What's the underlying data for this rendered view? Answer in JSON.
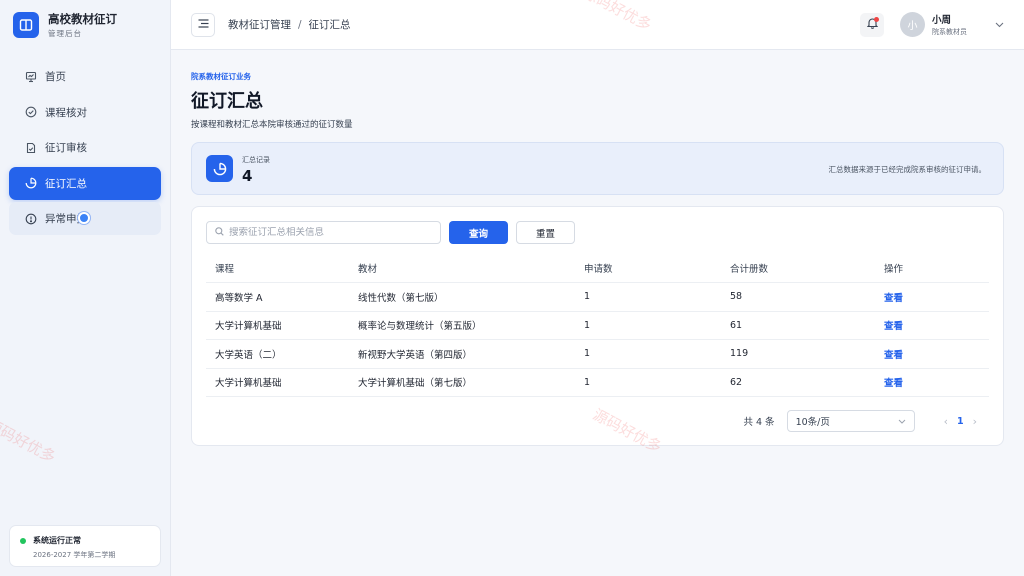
{
  "brand": {
    "title": "高校教材征订",
    "subtitle": "管理后台"
  },
  "sidebar": {
    "items": [
      {
        "label": "首页",
        "icon": "presentation-icon"
      },
      {
        "label": "课程核对",
        "icon": "check-circle-icon"
      },
      {
        "label": "征订审核",
        "icon": "document-check-icon"
      },
      {
        "label": "征订汇总",
        "icon": "pie-chart-icon"
      },
      {
        "label": "异常申报",
        "icon": "alert-circle-icon"
      }
    ],
    "status": {
      "title": "系统运行正常",
      "subtitle": "2026-2027 学年第二学期"
    }
  },
  "header": {
    "breadcrumb": [
      "教材征订管理",
      "征订汇总"
    ],
    "separator": "/",
    "user": {
      "avatar": "小",
      "name": "小周",
      "role": "院系教材员"
    }
  },
  "main": {
    "eyebrow": "院系教材征订业务",
    "title": "征订汇总",
    "description": "按课程和教材汇总本院审核通过的征订数量",
    "summary": {
      "label": "汇总记录",
      "count": "4",
      "note": "汇总数据来源于已经完成院系审核的征订申请。"
    },
    "search": {
      "placeholder": "搜索征订汇总相关信息",
      "value": ""
    },
    "buttons": {
      "query": "查询",
      "reset": "重置"
    },
    "table": {
      "headers": [
        "课程",
        "教材",
        "申请数",
        "合计册数",
        "操作"
      ],
      "rows": [
        [
          "高等数学 A",
          "线性代数（第七版）",
          "1",
          "58",
          "查看"
        ],
        [
          "大学计算机基础",
          "概率论与数理统计（第五版）",
          "1",
          "61",
          "查看"
        ],
        [
          "大学英语（二）",
          "新视野大学英语（第四版）",
          "1",
          "119",
          "查看"
        ],
        [
          "大学计算机基础",
          "大学计算机基础（第七版）",
          "1",
          "62",
          "查看"
        ]
      ]
    },
    "pagination": {
      "total": "共 4 条",
      "page_size": "10条/页",
      "current": "1",
      "prev": "‹",
      "next": "›"
    }
  },
  "watermark": "源码好优多",
  "colors": {
    "primary": "#2563eb",
    "success": "#22c55e",
    "danger": "#ef4444"
  }
}
